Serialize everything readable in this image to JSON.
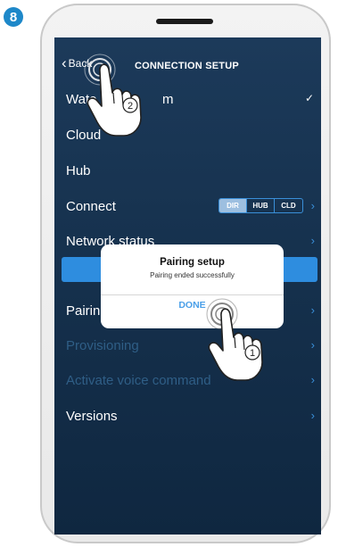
{
  "step": {
    "number": "8"
  },
  "nav": {
    "back_label": "Back",
    "title": "CONNECTION SETUP"
  },
  "menu": {
    "items": [
      {
        "label": "Water system",
        "visible_label": "Wate",
        "visible_tail": "m",
        "accessory": "check"
      },
      {
        "label": "Cloud"
      },
      {
        "label": "Hub"
      },
      {
        "label": "Connect",
        "segments": [
          "DIR",
          "HUB",
          "CLD"
        ],
        "selected_segment": "DIR"
      },
      {
        "label": "Network status"
      },
      {
        "label": ""
      },
      {
        "label": "Pairing",
        "visible_label": "Pairin"
      },
      {
        "label": "Provisioning",
        "disabled": true
      },
      {
        "label": "Activate voice command",
        "disabled": true
      },
      {
        "label": "Versions"
      }
    ]
  },
  "dialog": {
    "title": "Pairing setup",
    "message": "Pairing ended successfully",
    "button": "DONE",
    "button_visible": "DONE"
  },
  "annotations": {
    "tap_1": "1",
    "tap_2": "2"
  },
  "colors": {
    "screen_bg": "#15304c",
    "accent": "#2e8ddf",
    "badge": "#1e88c9",
    "disabled_text": "#2f5e86"
  }
}
